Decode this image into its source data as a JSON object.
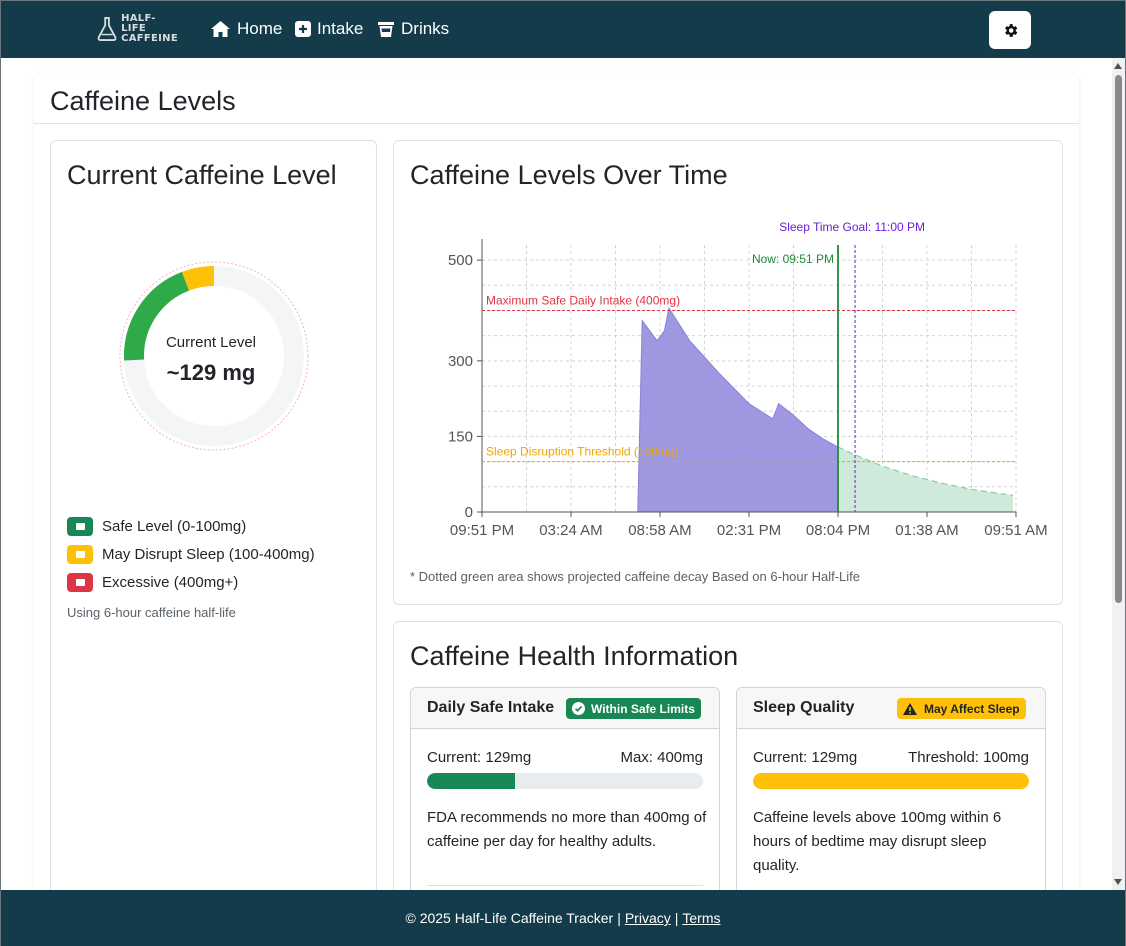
{
  "navbar": {
    "brand_line1": "HALF-LIFE",
    "brand_line2": "CAFFEINE",
    "items": [
      {
        "label": "Home",
        "icon": "home-icon"
      },
      {
        "label": "Intake",
        "icon": "plus-square-icon"
      },
      {
        "label": "Drinks",
        "icon": "cup-icon"
      }
    ],
    "settings_icon": "gear-icon"
  },
  "page": {
    "title": "Caffeine Levels"
  },
  "current_level": {
    "title": "Current Caffeine Level",
    "label": "Current Level",
    "value": "~129 mg",
    "gauge": {
      "value_mg": 129,
      "max_mg": 500
    },
    "legend": [
      {
        "label": "Safe Level (0-100mg)",
        "color": "#198754"
      },
      {
        "label": "May Disrupt Sleep (100-400mg)",
        "color": "#ffc107"
      },
      {
        "label": "Excessive (400mg+)",
        "color": "#dc3545"
      }
    ],
    "half_life_note": "Using 6-hour caffeine half-life"
  },
  "chart_card": {
    "title": "Caffeine Levels Over Time",
    "note": "* Dotted green area shows projected caffeine decay Based on 6-hour Half-Life"
  },
  "chart_data": {
    "type": "area",
    "x_ticks": [
      "09:51 PM",
      "03:24 AM",
      "08:58 AM",
      "02:31 PM",
      "08:04 PM",
      "01:38 AM",
      "09:51 AM"
    ],
    "x_range_hours": [
      0,
      36
    ],
    "y_ticks": [
      0,
      150,
      300,
      500
    ],
    "ylim": [
      0,
      530
    ],
    "series": [
      {
        "style": "filled",
        "color": "#9e98e0",
        "points": [
          [
            0,
            0
          ],
          [
            10.5,
            0
          ],
          [
            10.8,
            380
          ],
          [
            11.8,
            340
          ],
          [
            12.3,
            360
          ],
          [
            12.6,
            405
          ],
          [
            14,
            340
          ],
          [
            16,
            275
          ],
          [
            18,
            215
          ],
          [
            19.6,
            185
          ],
          [
            20,
            215
          ],
          [
            21,
            192
          ],
          [
            22,
            165
          ],
          [
            23,
            145
          ],
          [
            24,
            129
          ]
        ]
      },
      {
        "style": "dashed",
        "color": "#cfe9da",
        "points": [
          [
            24,
            129
          ],
          [
            25.1,
            114
          ],
          [
            27,
            91
          ],
          [
            29,
            72
          ],
          [
            31,
            57
          ],
          [
            33,
            45
          ],
          [
            35,
            36
          ],
          [
            35.8,
            33
          ]
        ]
      }
    ],
    "annotations": [
      {
        "label": "Maximum Safe Daily Intake (400mg)",
        "y": 400,
        "color": "#dc3545"
      },
      {
        "label": "Sleep Disruption Threshold (100mg)",
        "y": 100,
        "color": "#f0a500"
      },
      {
        "label": "Now: 09:51 PM",
        "x": 24,
        "color": "#1f8b35"
      },
      {
        "label": "Sleep Time Goal: 11:00 PM",
        "x": 25.15,
        "color": "#6a1ed8"
      }
    ],
    "grid": true
  },
  "health_info": {
    "title": "Caffeine Health Information",
    "daily": {
      "title": "Daily Safe Intake",
      "badge": "Within Safe Limits",
      "current": "Current: 129mg",
      "max": "Max: 400mg",
      "progress": 0.32,
      "color": "#198754",
      "text": "FDA recommends no more than 400mg of caffeine per day for healthy adults."
    },
    "sleep": {
      "title": "Sleep Quality",
      "badge": "May Affect Sleep",
      "current": "Current: 129mg",
      "threshold": "Threshold: 100mg",
      "progress": 1.0,
      "color": "#ffc107",
      "text": "Caffeine levels above 100mg within 6 hours of bedtime may disrupt sleep quality."
    }
  },
  "footer": {
    "copyright": "© 2025 Half-Life Caffeine Tracker",
    "privacy": "Privacy",
    "terms": "Terms"
  }
}
